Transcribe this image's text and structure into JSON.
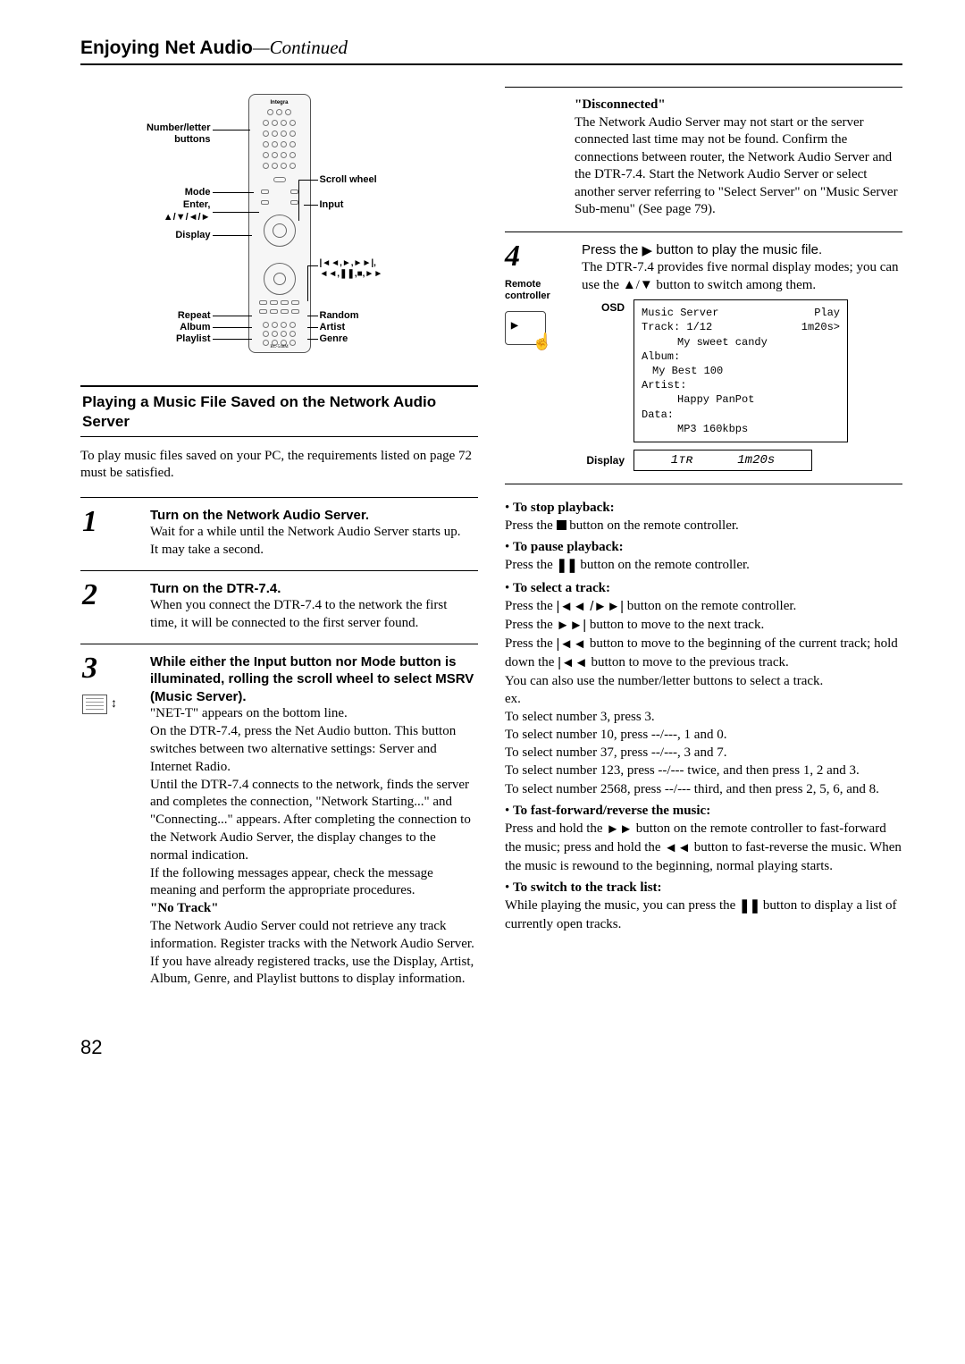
{
  "header": {
    "title": "Enjoying Net Audio",
    "continued": "—Continued"
  },
  "remote_labels": {
    "number_letter": "Number/letter\nbuttons",
    "mode": "Mode",
    "enter": "Enter,",
    "arrows": "▲/▼/◄/►",
    "display": "Display",
    "repeat": "Repeat",
    "album": "Album",
    "playlist": "Playlist",
    "scroll_wheel": "Scroll wheel",
    "input": "Input",
    "transport": "|◄◄,►,►►|,\n◄◄,❚❚,■,►►",
    "random": "Random",
    "artist": "Artist",
    "genre": "Genre",
    "brand": "Integra",
    "model": "RC-548M"
  },
  "section_head": "Playing a Music File Saved on the Network Audio Server",
  "intro": "To play music files saved on your PC, the requirements listed on page 72 must be satisfied.",
  "steps": {
    "s1": {
      "num": "1",
      "bold": "Turn on the Network Audio Server.",
      "l1": "Wait for a while until the Network Audio Server starts up.",
      "l2": "It may take a second."
    },
    "s2": {
      "num": "2",
      "bold": "Turn on the DTR-7.4.",
      "l1": "When you connect the DTR-7.4 to the network the first time, it will be connected to the first server found."
    },
    "s3": {
      "num": "3",
      "bold": "While either the Input button nor Mode button is illuminated, rolling the scroll wheel to select MSRV (Music Server).",
      "p1": "\"NET-T\" appears on the bottom line.",
      "p2": "On the DTR-7.4, press the Net Audio button. This button switches between two alternative settings: Server and Internet Radio.",
      "p3": "Until the DTR-7.4 connects to the network, finds the server and completes the connection, \"Network Starting...\" and \"Connecting...\" appears. After completing the connection to the Network Audio Server, the display changes to the normal indication.",
      "p4": "If the following messages appear, check the message meaning and perform the appropriate procedures.",
      "notrack_h": "\"No Track\"",
      "notrack_b": "The Network Audio Server could not retrieve any track information. Register tracks with the Network Audio Server. If you have already registered tracks, use the Display, Artist, Album, Genre, and Playlist buttons to display information."
    }
  },
  "disconnected": {
    "h": "\"Disconnected\"",
    "b": "The Network Audio Server may not start or the server connected last time may not be found. Confirm the connections between router, the Network Audio Server and the DTR-7.4. Start the Network Audio Server or select another server referring to \"Select Server\" on \"Music Server Sub-menu\" (See page 79)."
  },
  "step4": {
    "num": "4",
    "side1": "Remote",
    "side2": "controller",
    "bold_a": "Press the ",
    "bold_b": " button to play the music file.",
    "body": "The DTR-7.4 provides five normal display modes; you can use the ▲/▼ button to switch among them.",
    "osd_tag": "OSD",
    "display_tag": "Display"
  },
  "osd": {
    "title": "Music Server",
    "play": "Play",
    "track": "Track:  1/12",
    "time": "1m20s>",
    "song": "My sweet candy",
    "album_l": "Album:",
    "album_v": "My Best 100",
    "artist_l": "Artist:",
    "artist_v": "Happy PanPot",
    "data_l": "Data:",
    "data_v": "MP3  160kbps"
  },
  "display_panel": {
    "a": "1ᴛʀ",
    "b": "1m20s"
  },
  "bullets": {
    "stop_h": "To stop playback:",
    "stop_b1": "Press the ",
    "stop_b2": " button on the remote controller.",
    "pause_h": "To pause playback:",
    "pause_b1": "Press the ",
    "pause_b2": " button on the remote controller.",
    "select_h": "To select a track:",
    "select_p1a": "Press the ",
    "select_p1b": " button on the remote controller.",
    "select_p2a": "Press the ",
    "select_p2b": " button to move to the next track.",
    "select_p3a": "Press the ",
    "select_p3b": " button to move to the beginning of the current track; hold down the ",
    "select_p3c": " button to move to the previous track.",
    "select_p4": "You can also use the number/letter buttons to select a track.",
    "ex": "ex.",
    "ex1": "To select number 3, press 3.",
    "ex2": "To select number 10, press --/---, 1 and 0.",
    "ex3": "To select number 37, press --/---, 3 and 7.",
    "ex4": "To select number 123, press --/--- twice, and then press 1, 2 and 3.",
    "ex5": "To select number 2568, press --/--- third, and then press 2, 5, 6, and 8.",
    "ff_h": "To fast-forward/reverse the music:",
    "ff_b1": "Press and hold the ",
    "ff_b2": " button on the remote controller to fast-forward the music; press and hold the ",
    "ff_b3": " button to fast-reverse the music. When the music is rewound to the beginning, normal playing starts.",
    "list_h": "To switch to the track list:",
    "list_b1": "While playing the music, you can press the ",
    "list_b2": " button to display a list of currently open tracks."
  },
  "page_number": "82"
}
